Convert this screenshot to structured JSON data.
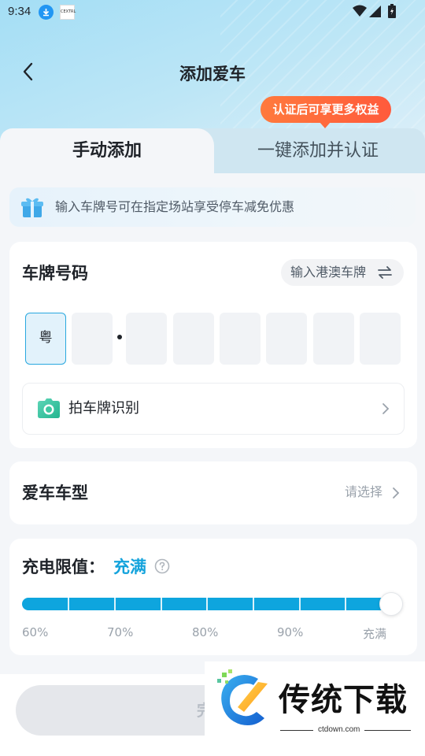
{
  "status_bar": {
    "time": "9:34",
    "app_icon_text": "CEXTRL"
  },
  "header": {
    "title": "添加爱车"
  },
  "promo_badge": "认证后可享更多权益",
  "tabs": [
    {
      "label": "手动添加",
      "active": true
    },
    {
      "label": "一键添加并认证",
      "active": false
    }
  ],
  "tip": {
    "text": "输入车牌号可在指定场站享受停车减免优惠",
    "icon": "gift-icon"
  },
  "plate": {
    "title": "车牌号码",
    "hk_macau_button": "输入港澳车牌",
    "province": "粤",
    "slots": [
      "",
      "",
      "",
      "",
      "",
      "",
      ""
    ],
    "ocr_label": "拍车牌识别"
  },
  "model": {
    "title": "爱车车型",
    "placeholder": "请选择"
  },
  "charge_limit": {
    "label": "充电限值：",
    "value": "充满",
    "level_percent": 100,
    "ticks": [
      "60%",
      "70%",
      "80%",
      "90%",
      "充满"
    ]
  },
  "footer": {
    "complete_button": "完成"
  },
  "watermark": {
    "brand": "传统下载",
    "url": "ctdown.com"
  },
  "colors": {
    "accent": "#14a3dc",
    "badge": "#ff6a3c",
    "slider": "#0ea5de"
  }
}
